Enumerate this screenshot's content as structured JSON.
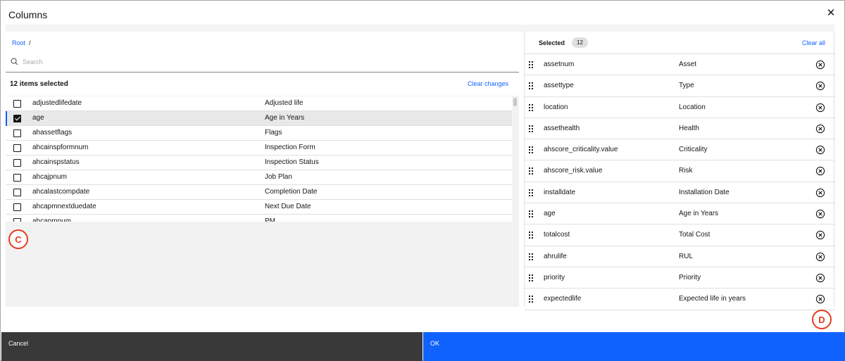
{
  "modal": {
    "title": "Columns"
  },
  "breadcrumb": {
    "root": "Root",
    "separator": "/"
  },
  "search": {
    "placeholder": "Search",
    "value": ""
  },
  "available": {
    "selected_count_label": "12 items selected",
    "clear_changes_label": "Clear changes",
    "rows": [
      {
        "name": "adjustedlifedate",
        "description": "Adjusted life",
        "checked": false
      },
      {
        "name": "age",
        "description": "Age in Years",
        "checked": true
      },
      {
        "name": "ahassetflags",
        "description": "Flags",
        "checked": false
      },
      {
        "name": "ahcainspformnum",
        "description": "Inspection Form",
        "checked": false
      },
      {
        "name": "ahcainspstatus",
        "description": "Inspection Status",
        "checked": false
      },
      {
        "name": "ahcajpnum",
        "description": "Job Plan",
        "checked": false
      },
      {
        "name": "ahcalastcompdate",
        "description": "Completion Date",
        "checked": false
      },
      {
        "name": "ahcapmnextduedate",
        "description": "Next Due Date",
        "checked": false
      },
      {
        "name": "ahcapmnum",
        "description": "PM",
        "checked": false
      }
    ]
  },
  "selected": {
    "title": "Selected",
    "count": "12",
    "clear_all_label": "Clear all",
    "rows": [
      {
        "name": "assetnum",
        "description": "Asset"
      },
      {
        "name": "assettype",
        "description": "Type"
      },
      {
        "name": "location",
        "description": "Location"
      },
      {
        "name": "assethealth",
        "description": "Health"
      },
      {
        "name": "ahscore_criticality.value",
        "description": "Criticality"
      },
      {
        "name": "ahscore_risk.value",
        "description": "Risk"
      },
      {
        "name": "installdate",
        "description": "Installation Date"
      },
      {
        "name": "age",
        "description": "Age in Years"
      },
      {
        "name": "totalcost",
        "description": "Total Cost"
      },
      {
        "name": "ahrulife",
        "description": "RUL"
      },
      {
        "name": "priority",
        "description": "Priority"
      },
      {
        "name": "expectedlife",
        "description": "Expected life in years"
      }
    ]
  },
  "markers": {
    "c": "C",
    "d": "D"
  },
  "footer": {
    "cancel_label": "Cancel",
    "ok_label": "OK"
  },
  "colors": {
    "accent": "#0f62fe",
    "cancel_bg": "#393939",
    "marker": "#e23d1e"
  },
  "icons": {
    "close": "close-icon",
    "search": "search-icon",
    "drag": "drag-handle-icon",
    "remove": "remove-circle-icon"
  }
}
